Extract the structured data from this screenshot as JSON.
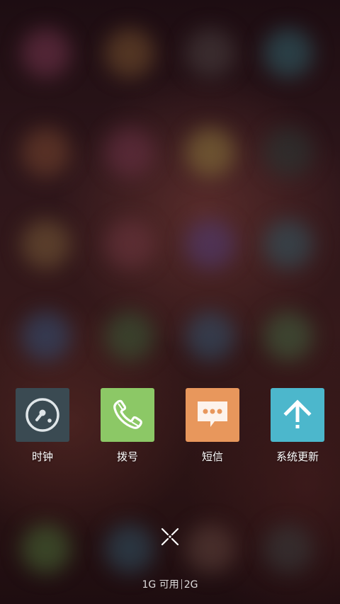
{
  "apps": [
    {
      "label": "时钟",
      "icon": "clock-icon",
      "color": "#3a4a52"
    },
    {
      "label": "拨号",
      "icon": "phone-icon",
      "color": "#8cc866"
    },
    {
      "label": "短信",
      "icon": "message-icon",
      "color": "#e8975c"
    },
    {
      "label": "系统更新",
      "icon": "arrow-up-icon",
      "color": "#4cb7cc"
    }
  ],
  "memory": {
    "available": "1G 可用",
    "total": "2G"
  }
}
